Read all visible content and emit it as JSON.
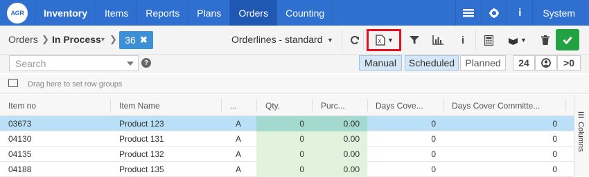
{
  "nav": {
    "logo_text": "AGR",
    "brand": "Inventory",
    "items": [
      "Items",
      "Reports",
      "Plans",
      "Orders",
      "Counting"
    ],
    "active": "Orders",
    "system_label": "System"
  },
  "toolbar": {
    "breadcrumb_root": "Orders",
    "breadcrumb_current": "In Process",
    "count": "36",
    "view_name": "Orderlines - standard"
  },
  "search": {
    "placeholder": "Search"
  },
  "modes": [
    "Manual",
    "Scheduled",
    "Planned"
  ],
  "active_mode": "Manual",
  "quick_filters": {
    "days": "24",
    "gt_zero": ">0"
  },
  "grid": {
    "row_group_hint": "Drag here to set row groups",
    "columns": [
      "Item no",
      "Item Name",
      "...",
      "Qty.",
      "Purc...",
      "Days Cove...",
      "Days Cover Committe..."
    ],
    "rows": [
      {
        "item_no": "03673",
        "item_name": "Product 123",
        "abc": "A",
        "qty": "0",
        "purchase": "0.00",
        "days_cover": "0",
        "days_cover_committed": "0",
        "selected": true
      },
      {
        "item_no": "04130",
        "item_name": "Product 131",
        "abc": "A",
        "qty": "0",
        "purchase": "0.00",
        "days_cover": "0",
        "days_cover_committed": "0",
        "selected": false
      },
      {
        "item_no": "04135",
        "item_name": "Product 132",
        "abc": "A",
        "qty": "0",
        "purchase": "0.00",
        "days_cover": "0",
        "days_cover_committed": "0",
        "selected": false
      },
      {
        "item_no": "04188",
        "item_name": "Product 135",
        "abc": "A",
        "qty": "0",
        "purchase": "0.00",
        "days_cover": "0",
        "days_cover_committed": "0",
        "selected": false
      }
    ],
    "side_panel_label": "Columns"
  },
  "colors": {
    "nav_bg": "#2f6fcf",
    "nav_active": "#1f58b3",
    "accent_badge": "#3d8fd6",
    "confirm_green": "#22a243",
    "highlight_red": "#e8101c",
    "selected_row": "#b9e0f7",
    "qty_column_bg": "#e2f3dd"
  },
  "icons": {
    "nav": [
      "menu-lines-icon",
      "gear-icon",
      "info-icon"
    ],
    "toolbar": [
      "refresh-icon",
      "excel-export-icon",
      "filter-icon",
      "chart-icon",
      "info-icon",
      "calculator-icon",
      "box-icon",
      "trash-icon",
      "check-icon"
    ],
    "filters": [
      "help-icon",
      "user-circle-icon"
    ]
  }
}
